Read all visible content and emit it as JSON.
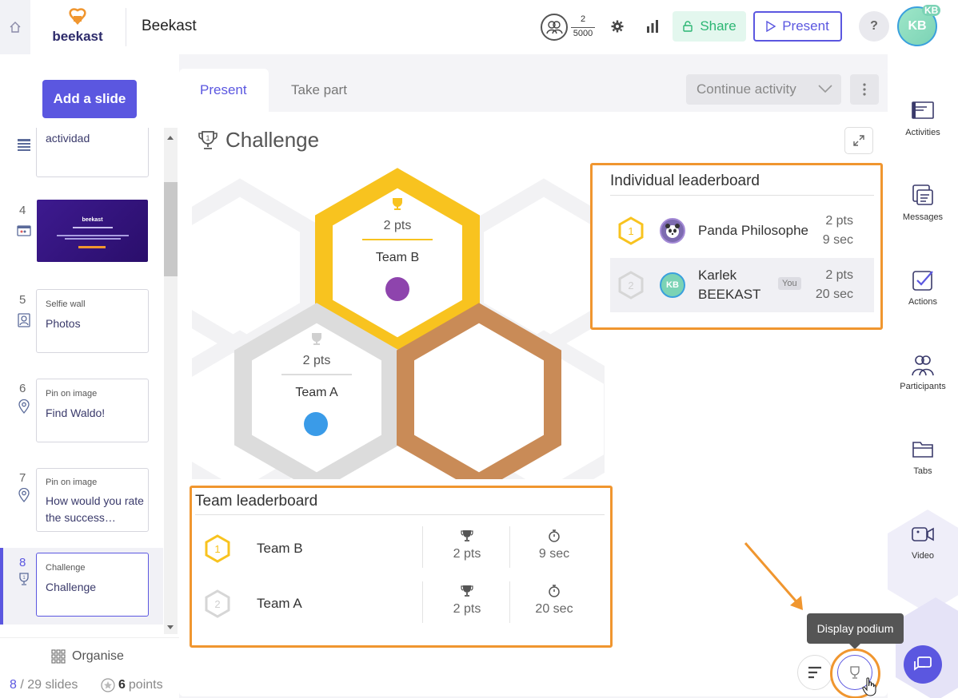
{
  "app": {
    "brand": "beekast",
    "title": "Beekast",
    "participants_current": "2",
    "participants_max": "5000",
    "share_label": "Share",
    "present_label": "Present",
    "help_label": "?",
    "avatar_initials": "KB",
    "avatar_badge": "KB"
  },
  "left_panel": {
    "add_slide_label": "Add a slide",
    "slides": [
      {
        "number": "",
        "type": "Form",
        "title": "actividad"
      },
      {
        "number": "4",
        "type": "",
        "title": "",
        "thumb_brand": "beekast"
      },
      {
        "number": "5",
        "type": "Selfie wall",
        "title": "Photos"
      },
      {
        "number": "6",
        "type": "Pin on image",
        "title": "Find Waldo!"
      },
      {
        "number": "7",
        "type": "Pin on image",
        "title": "How would you rate the success…"
      },
      {
        "number": "8",
        "type": "Challenge",
        "title": "Challenge"
      }
    ],
    "organise_label": "Organise",
    "slide_current": "8",
    "slide_total_label": "/ 29 slides",
    "points_value": "6",
    "points_label": "points"
  },
  "main": {
    "tabs": [
      {
        "label": "Present",
        "active": true
      },
      {
        "label": "Take part",
        "active": false
      }
    ],
    "continue_label": "Continue activity",
    "activity_title": "Challenge",
    "podium": {
      "first": {
        "points": "2 pts",
        "team": "Team B",
        "color": "#8e44ad"
      },
      "second": {
        "points": "2 pts",
        "team": "Team A",
        "color": "#3a9be8"
      }
    },
    "individual_leaderboard": {
      "title": "Individual leaderboard",
      "rows": [
        {
          "rank": "1",
          "name": "Panda Philosophe",
          "points": "2 pts",
          "time": "9 sec",
          "you": ""
        },
        {
          "rank": "2",
          "name": "Karlek BEEKAST",
          "points": "2 pts",
          "time": "20 sec",
          "you": "You",
          "initials": "KB"
        }
      ]
    },
    "team_leaderboard": {
      "title": "Team leaderboard",
      "rows": [
        {
          "rank": "1",
          "name": "Team B",
          "points": "2 pts",
          "time": "9 sec"
        },
        {
          "rank": "2",
          "name": "Team A",
          "points": "2 pts",
          "time": "20 sec"
        }
      ]
    },
    "tooltip": "Display podium"
  },
  "right_rail": {
    "items": [
      {
        "label": "Activities",
        "icon": "activities-icon"
      },
      {
        "label": "Messages",
        "icon": "messages-icon"
      },
      {
        "label": "Actions",
        "icon": "actions-icon"
      },
      {
        "label": "Participants",
        "icon": "participants-icon"
      },
      {
        "label": "Tabs",
        "icon": "tabs-icon"
      },
      {
        "label": "Video",
        "icon": "video-icon"
      }
    ]
  },
  "colors": {
    "accent": "#5b57e0",
    "gold": "#f8c31f",
    "silver": "#dcdcdc",
    "bronze": "#c98b57",
    "annotation": "#f0962f",
    "share_green": "#2bb673"
  }
}
